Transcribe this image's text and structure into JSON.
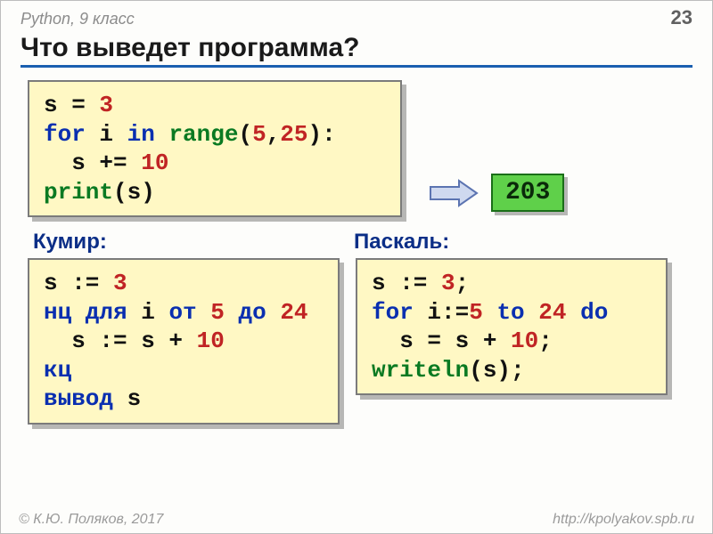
{
  "header": {
    "course": "Python, 9 класс",
    "page": "23"
  },
  "title": "Что выведет программа?",
  "python_code": {
    "l1a": "s = ",
    "l1v": "3",
    "l2a": "for",
    "l2b": " i ",
    "l2c": "in",
    "l2d": " ",
    "l2fn": "range",
    "l2e": "(",
    "l2v1": "5",
    "l2f": ",",
    "l2v2": "25",
    "l2g": "):",
    "l3a": "  s += ",
    "l3v": "10",
    "l4fn": "print",
    "l4a": "(s)"
  },
  "result": "203",
  "labels": {
    "kumir": "Кумир:",
    "pascal": "Паскаль:"
  },
  "kumir_code": {
    "l1a": "s := ",
    "l1v": "3",
    "l2a": "нц для",
    "l2b": " i ",
    "l2c": "от",
    "l2d": " ",
    "l2v1": "5",
    "l2e": " ",
    "l2f": "до",
    "l2g": " ",
    "l2v2": "24",
    "l3a": "  s := s + ",
    "l3v": "10",
    "l4a": "кц",
    "l5a": "вывод",
    "l5b": " s"
  },
  "pascal_code": {
    "l1a": "s := ",
    "l1v": "3",
    "l1b": ";",
    "l2a": "for",
    "l2b": " i:=",
    "l2v1": "5",
    "l2c": " ",
    "l2d": "to",
    "l2e": " ",
    "l2v2": "24",
    "l2f": " ",
    "l2g": "do",
    "l3a": "  s = s + ",
    "l3v": "10",
    "l3b": ";",
    "l4fn": "writeln",
    "l4a": "(s);"
  },
  "footer": {
    "left": "© К.Ю. Поляков, 2017",
    "right": "http://kpolyakov.spb.ru"
  }
}
